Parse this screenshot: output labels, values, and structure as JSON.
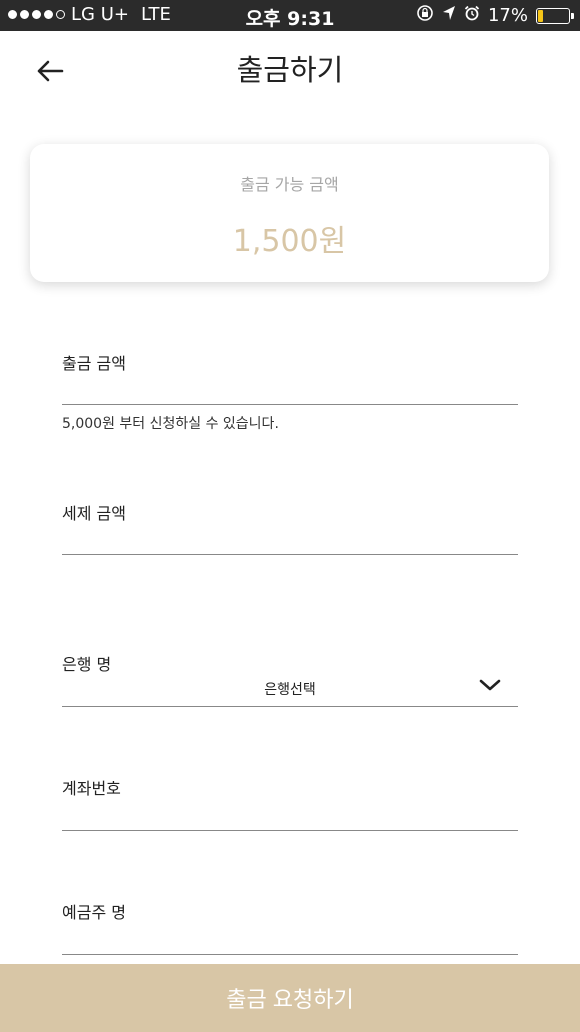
{
  "status_bar": {
    "carrier": "LG U+",
    "network": "LTE",
    "time": "오후 9:31",
    "battery_percent": "17%",
    "battery_level": 0.17
  },
  "header": {
    "title": "출금하기"
  },
  "balance": {
    "label": "출금 가능 금액",
    "amount": "1,500원"
  },
  "form": {
    "withdraw_amount": {
      "label": "출금 금액",
      "value": "",
      "hint": "5,000원 부터 신청하실 수 있습니다."
    },
    "tax_amount": {
      "label": "세제 금액",
      "value": ""
    },
    "bank_name": {
      "label": "은행 명",
      "selected": "은행선택"
    },
    "account_number": {
      "label": "계좌번호",
      "value": ""
    },
    "account_holder": {
      "label": "예금주 명",
      "value": ""
    }
  },
  "submit": {
    "label": "출금 요청하기"
  },
  "colors": {
    "accent": "#d8c6a6",
    "status_bar_bg": "#2b2b2b",
    "muted_text": "#a6a6a6"
  }
}
